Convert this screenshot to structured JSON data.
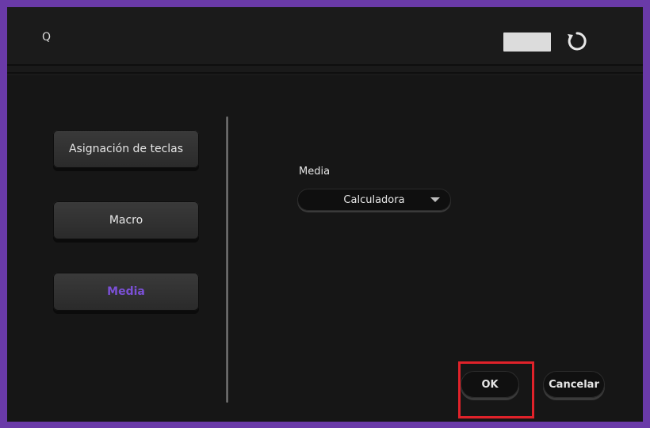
{
  "header": {
    "title_letter": "Q",
    "swatch_color": "#dcdcdc",
    "refresh_icon": "refresh-icon"
  },
  "sidebar": {
    "items": [
      {
        "label": "Asignación de teclas",
        "active": false
      },
      {
        "label": "Macro",
        "active": false
      },
      {
        "label": "Media",
        "active": true
      }
    ],
    "active_color": "#7b50d6"
  },
  "main": {
    "media_label": "Media",
    "media_select": {
      "value": "Calculadora"
    }
  },
  "footer": {
    "ok_label": "OK",
    "cancel_label": "Cancelar"
  },
  "colors": {
    "frame": "#6a3aa8",
    "background": "#161616",
    "highlight": "#e0222a"
  }
}
